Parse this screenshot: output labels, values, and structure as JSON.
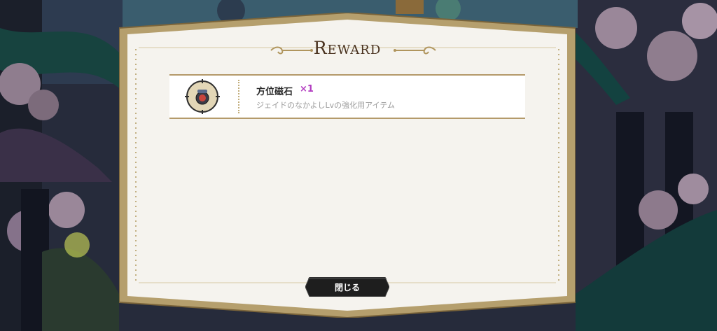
{
  "dialog": {
    "title": "Reward",
    "reward": {
      "name": "方位磁石",
      "quantity": "×1",
      "description": "ジェイドのなかよしLvの強化用アイテム",
      "icon": "compass-icon"
    },
    "close_label": "閉じる"
  },
  "colors": {
    "frame_gold": "#b59f6d",
    "panel": "#f5f3ee",
    "quantity_accent": "#b23cc0",
    "title": "#4a3320",
    "button": "#1e1e1e"
  }
}
